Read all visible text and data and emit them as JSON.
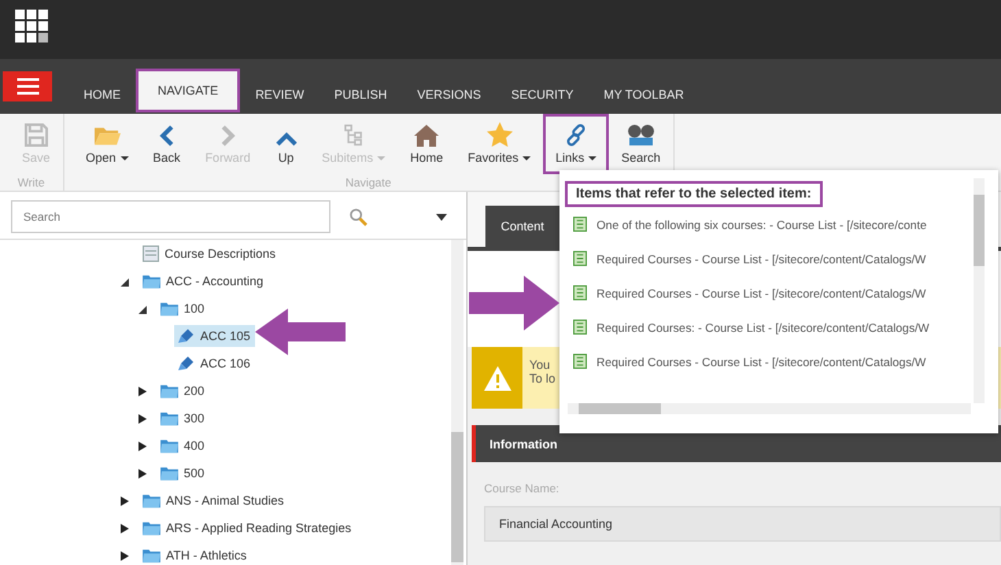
{
  "menu_tabs": [
    {
      "label": "HOME",
      "selected": false,
      "annotated": false
    },
    {
      "label": "NAVIGATE",
      "selected": true,
      "annotated": true
    },
    {
      "label": "REVIEW",
      "selected": false,
      "annotated": false
    },
    {
      "label": "PUBLISH",
      "selected": false,
      "annotated": false
    },
    {
      "label": "VERSIONS",
      "selected": false,
      "annotated": false
    },
    {
      "label": "SECURITY",
      "selected": false,
      "annotated": false
    },
    {
      "label": "MY TOOLBAR",
      "selected": false,
      "annotated": false
    }
  ],
  "ribbon_groups": [
    {
      "label": "Write",
      "buttons": [
        {
          "label": "Save",
          "kind": "save",
          "disabled": true,
          "dropdown": false,
          "annotated": false
        }
      ]
    },
    {
      "label": "Navigate",
      "buttons": [
        {
          "label": "Open",
          "kind": "folder",
          "disabled": false,
          "dropdown": true,
          "annotated": false
        },
        {
          "label": "Back",
          "kind": "back",
          "disabled": false,
          "dropdown": false,
          "annotated": false
        },
        {
          "label": "Forward",
          "kind": "forward",
          "disabled": true,
          "dropdown": false,
          "annotated": false
        },
        {
          "label": "Up",
          "kind": "up",
          "disabled": false,
          "dropdown": false,
          "annotated": false
        },
        {
          "label": "Subitems",
          "kind": "tree",
          "disabled": true,
          "dropdown": true,
          "annotated": false
        },
        {
          "label": "Home",
          "kind": "home",
          "disabled": false,
          "dropdown": false,
          "annotated": false
        },
        {
          "label": "Favorites",
          "kind": "star",
          "disabled": false,
          "dropdown": true,
          "annotated": false
        },
        {
          "label": "Links",
          "kind": "link",
          "disabled": false,
          "dropdown": true,
          "annotated": true
        },
        {
          "label": "Search",
          "kind": "binoculars",
          "disabled": false,
          "dropdown": false,
          "annotated": false
        }
      ]
    }
  ],
  "search": {
    "placeholder": "Search"
  },
  "tree": [
    {
      "label": "Course Descriptions",
      "kind": "doc",
      "selected": false
    },
    {
      "label": "ACC - Accounting",
      "kind": "folder",
      "selected": false,
      "expanded": true,
      "children": [
        {
          "label": "100",
          "kind": "folder",
          "selected": false,
          "expanded": true,
          "children": [
            {
              "label": "ACC 105",
              "kind": "item",
              "selected": true
            },
            {
              "label": "ACC 106",
              "kind": "item",
              "selected": false
            }
          ]
        },
        {
          "label": "200",
          "kind": "folder",
          "selected": false,
          "expanded": false
        },
        {
          "label": "300",
          "kind": "folder",
          "selected": false,
          "expanded": false
        },
        {
          "label": "400",
          "kind": "folder",
          "selected": false,
          "expanded": false
        },
        {
          "label": "500",
          "kind": "folder",
          "selected": false,
          "expanded": false
        }
      ]
    },
    {
      "label": "ANS - Animal Studies",
      "kind": "folder",
      "selected": false,
      "expanded": false
    },
    {
      "label": "ARS - Applied Reading Strategies",
      "kind": "folder",
      "selected": false,
      "expanded": false
    },
    {
      "label": "ATH - Athletics",
      "kind": "folder",
      "selected": false,
      "expanded": false
    }
  ],
  "editor": {
    "tabs": [
      {
        "label": "Content",
        "selected": true
      }
    ],
    "warning": {
      "lines": [
        "You",
        "To lo"
      ]
    },
    "section": {
      "title": "Information"
    },
    "fields": [
      {
        "label": "Course Name:",
        "value": "Financial Accounting"
      }
    ]
  },
  "links_dropdown": {
    "header": "Items that refer to the selected item:",
    "annotated": true,
    "items": [
      "One of the following six courses: - Course List - [/sitecore/conte",
      "Required Courses - Course List - [/sitecore/content/Catalogs/W",
      "Required Courses - Course List - [/sitecore/content/Catalogs/W",
      "Required Courses: - Course List - [/sitecore/content/Catalogs/W",
      "Required Courses - Course List - [/sitecore/content/Catalogs/W"
    ]
  }
}
